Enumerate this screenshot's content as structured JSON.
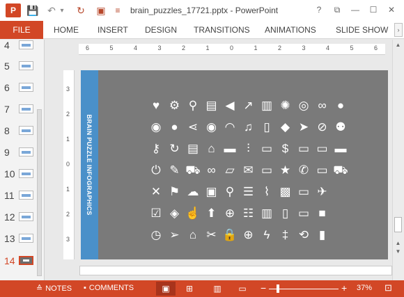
{
  "titlebar": {
    "app_icon": "P",
    "title": "brain_puzzles_17721.pptx - PowerPoint",
    "qat": [
      {
        "name": "save-icon",
        "glyph": "💾"
      },
      {
        "name": "undo-icon",
        "glyph": "↶"
      },
      {
        "name": "undo-dropdown-icon",
        "glyph": "▾"
      },
      {
        "name": "redo-icon",
        "glyph": "↻"
      },
      {
        "name": "start-slideshow-icon",
        "glyph": "▣"
      },
      {
        "name": "customize-qat-icon",
        "glyph": "≡"
      }
    ],
    "window_buttons": [
      "?",
      "⧉",
      "—",
      "☐",
      "✕"
    ]
  },
  "ribbon": {
    "file": "FILE",
    "tabs": [
      "HOME",
      "INSERT",
      "DESIGN",
      "TRANSITIONS",
      "ANIMATIONS",
      "SLIDE SHOW"
    ],
    "scroll": "›"
  },
  "thumbnails": {
    "items": [
      {
        "num": "4"
      },
      {
        "num": "5"
      },
      {
        "num": "6"
      },
      {
        "num": "7"
      },
      {
        "num": "8"
      },
      {
        "num": "9"
      },
      {
        "num": "10"
      },
      {
        "num": "11"
      },
      {
        "num": "12"
      },
      {
        "num": "13"
      },
      {
        "num": "14",
        "active": true
      }
    ]
  },
  "rulers": {
    "horizontal": [
      "6",
      "5",
      "4",
      "3",
      "2",
      "1",
      "0",
      "1",
      "2",
      "3",
      "4",
      "5",
      "6"
    ],
    "vertical": [
      "3",
      "2",
      "1",
      "0",
      "1",
      "2",
      "3"
    ]
  },
  "slide": {
    "side_title": "BRAIN PUZZLE INFOGRAPHICS",
    "background": "#7a7a7a",
    "strip_color": "#4a90c9",
    "icons": [
      [
        "heart-icon",
        "gear-icon",
        "map-pin-icon",
        "map-icon",
        "speaker-icon",
        "trend-up-icon",
        "bar-chart-icon",
        "loading-icon",
        "target-icon",
        "glasses-icon",
        "user-icon"
      ],
      [
        "lightbulb-icon",
        "speech-bubble-icon",
        "share-icon",
        "eye-icon",
        "wifi-icon",
        "music-icon",
        "phone-icon",
        "tag-icon",
        "cursor-icon",
        "compass-icon",
        "group-icon"
      ],
      [
        "key-icon",
        "refresh-icon",
        "document-icon",
        "microphone-icon",
        "folder-icon",
        "sliders-icon",
        "tablet-icon",
        "dollar-icon",
        "file-icon",
        "battery-empty-icon",
        "car-icon"
      ],
      [
        "power-icon",
        "pencil-icon",
        "cart-icon",
        "link-icon",
        "folder-open-icon",
        "envelope-icon",
        "monitor-icon",
        "star-icon",
        "telephone-icon",
        "battery-low-icon",
        "truck-icon"
      ],
      [
        "close-icon",
        "flag-icon",
        "cloud-icon",
        "inbox-icon",
        "search-icon",
        "list-icon",
        "paperclip-icon",
        "image-icon",
        "battery-medium-icon",
        "airplane-icon"
      ],
      [
        "checkbox-icon",
        "layers-icon",
        "hand-pointer-icon",
        "arrow-up-icon",
        "zoom-in-icon",
        "bulleted-list-icon",
        "trash-icon",
        "book-icon",
        "battery-charging-icon",
        "video-camera-icon"
      ],
      [
        "clock-icon",
        "paper-plane-icon",
        "home-icon",
        "scissors-icon",
        "lock-icon",
        "zoom-tool-icon",
        "lightning-icon",
        "pin-icon",
        "battery-cycle-icon",
        "battery-full-icon"
      ]
    ],
    "glyphs": {
      "heart-icon": "♥",
      "gear-icon": "⚙",
      "map-pin-icon": "⚲",
      "map-icon": "▤",
      "speaker-icon": "◀",
      "trend-up-icon": "↗",
      "bar-chart-icon": "▥",
      "loading-icon": "✺",
      "target-icon": "◎",
      "glasses-icon": "∞",
      "user-icon": "●",
      "lightbulb-icon": "◉",
      "speech-bubble-icon": "●",
      "share-icon": "⋖",
      "eye-icon": "◉",
      "wifi-icon": "◠",
      "music-icon": "♫",
      "phone-icon": "▯",
      "tag-icon": "◆",
      "cursor-icon": "➤",
      "compass-icon": "⊘",
      "group-icon": "⚉",
      "key-icon": "⚷",
      "refresh-icon": "↻",
      "document-icon": "▤",
      "microphone-icon": "⌂",
      "folder-icon": "▬",
      "sliders-icon": "⫶",
      "tablet-icon": "▭",
      "dollar-icon": "$",
      "file-icon": "▭",
      "battery-empty-icon": "▭",
      "car-icon": "▬",
      "power-icon": "⏻",
      "pencil-icon": "✎",
      "cart-icon": "⛟",
      "link-icon": "∞",
      "folder-open-icon": "▱",
      "envelope-icon": "✉",
      "monitor-icon": "▭",
      "star-icon": "★",
      "telephone-icon": "✆",
      "battery-low-icon": "▭",
      "truck-icon": "⛟",
      "close-icon": "✕",
      "flag-icon": "⚑",
      "cloud-icon": "☁",
      "inbox-icon": "▣",
      "search-icon": "⚲",
      "list-icon": "☰",
      "paperclip-icon": "⌇",
      "image-icon": "▩",
      "battery-medium-icon": "▭",
      "airplane-icon": "✈",
      "checkbox-icon": "☑",
      "layers-icon": "◈",
      "hand-pointer-icon": "☝",
      "arrow-up-icon": "⬆",
      "zoom-in-icon": "⊕",
      "bulleted-list-icon": "☷",
      "trash-icon": "▥",
      "book-icon": "▯",
      "battery-charging-icon": "▭",
      "video-camera-icon": "■",
      "clock-icon": "◷",
      "paper-plane-icon": "➢",
      "home-icon": "⌂",
      "scissors-icon": "✂",
      "lock-icon": "🔒",
      "zoom-tool-icon": "⊕",
      "lightning-icon": "ϟ",
      "pin-icon": "‡",
      "battery-cycle-icon": "⟲",
      "battery-full-icon": "▮"
    }
  },
  "statusbar": {
    "notes": "NOTES",
    "comments": "COMMENTS",
    "zoom_out": "−",
    "zoom_in": "+",
    "zoom_level": "37%",
    "zoom_fraction": 0.37
  }
}
